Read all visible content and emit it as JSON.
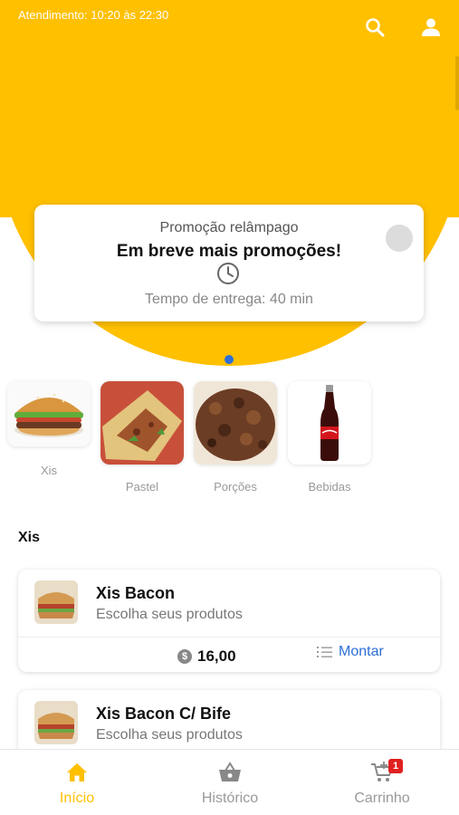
{
  "header": {
    "hours_text": "Atendimento: 10:20 às 22:30",
    "search_icon": "search-icon",
    "user_icon": "user-icon",
    "brand_color": "#FFC000"
  },
  "promo": {
    "label": "Promoção relâmpago",
    "title": "Em breve mais promoções!",
    "clock_icon": "clock-icon",
    "delivery_time": "Tempo de entrega: 40 min"
  },
  "carousel": {
    "active_index": 0,
    "dot_color": "#2d6fd6"
  },
  "categories": [
    {
      "label": "Xis"
    },
    {
      "label": "Pastel"
    },
    {
      "label": "Porções"
    },
    {
      "label": "Bebidas"
    }
  ],
  "section": {
    "title": "Xis"
  },
  "products": [
    {
      "name": "Xis Bacon",
      "subtitle": "Escolha seus produtos",
      "price": "16,00",
      "action_label": "Montar"
    },
    {
      "name": "Xis Bacon C/ Bife",
      "subtitle": "Escolha seus produtos"
    }
  ],
  "bottom_nav": {
    "items": [
      {
        "label": "Início",
        "icon": "home-icon",
        "active": true
      },
      {
        "label": "Histórico",
        "icon": "basket-icon",
        "active": false
      },
      {
        "label": "Carrinho",
        "icon": "cart-icon",
        "active": false,
        "badge": "1"
      }
    ],
    "active_color": "#FFC000",
    "badge_color": "#e02020"
  }
}
